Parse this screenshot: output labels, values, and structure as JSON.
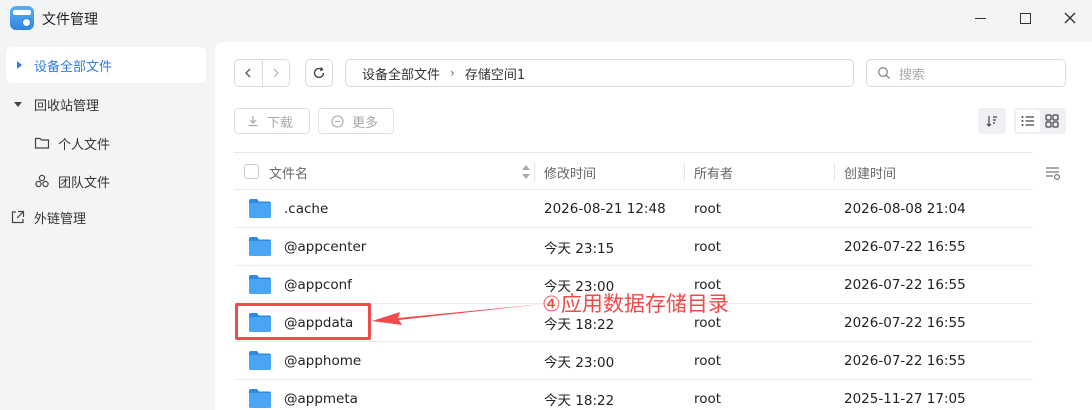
{
  "window": {
    "title": "文件管理"
  },
  "sidebar": {
    "items": [
      {
        "label": "设备全部文件",
        "active": true
      },
      {
        "label": "回收站管理",
        "expanded": true
      },
      {
        "label": "个人文件",
        "icon": "folder-outline-icon"
      },
      {
        "label": "团队文件",
        "icon": "team-icon"
      },
      {
        "label": "外链管理",
        "icon": "external-link-icon"
      }
    ]
  },
  "breadcrumb": {
    "items": [
      "设备全部文件",
      "存储空间1"
    ],
    "separator": "›"
  },
  "search": {
    "placeholder": "搜索"
  },
  "toolbar": {
    "download_label": "下载",
    "more_label": "更多"
  },
  "table": {
    "columns": [
      "文件名",
      "修改时间",
      "所有者",
      "创建时间"
    ],
    "rows": [
      {
        "name": ".cache",
        "modified": "2026-08-21 12:48",
        "owner": "root",
        "created": "2026-08-08 21:04"
      },
      {
        "name": "@appcenter",
        "modified": "今天 23:15",
        "owner": "root",
        "created": "2026-07-22 16:55"
      },
      {
        "name": "@appconf",
        "modified": "今天 23:00",
        "owner": "root",
        "created": "2026-07-22 16:55"
      },
      {
        "name": "@appdata",
        "modified": "今天 18:22",
        "owner": "root",
        "created": "2026-07-22 16:55"
      },
      {
        "name": "@apphome",
        "modified": "今天 23:00",
        "owner": "root",
        "created": "2026-07-22 16:55"
      },
      {
        "name": "@appmeta",
        "modified": "今天 18:22",
        "owner": "root",
        "created": "2025-11-27 17:05"
      }
    ]
  },
  "annotation": {
    "text": "④应用数据存储目录",
    "color": "#ef4b4b"
  },
  "colors": {
    "accent": "#2f7de1",
    "folder": "#3a9df0"
  }
}
